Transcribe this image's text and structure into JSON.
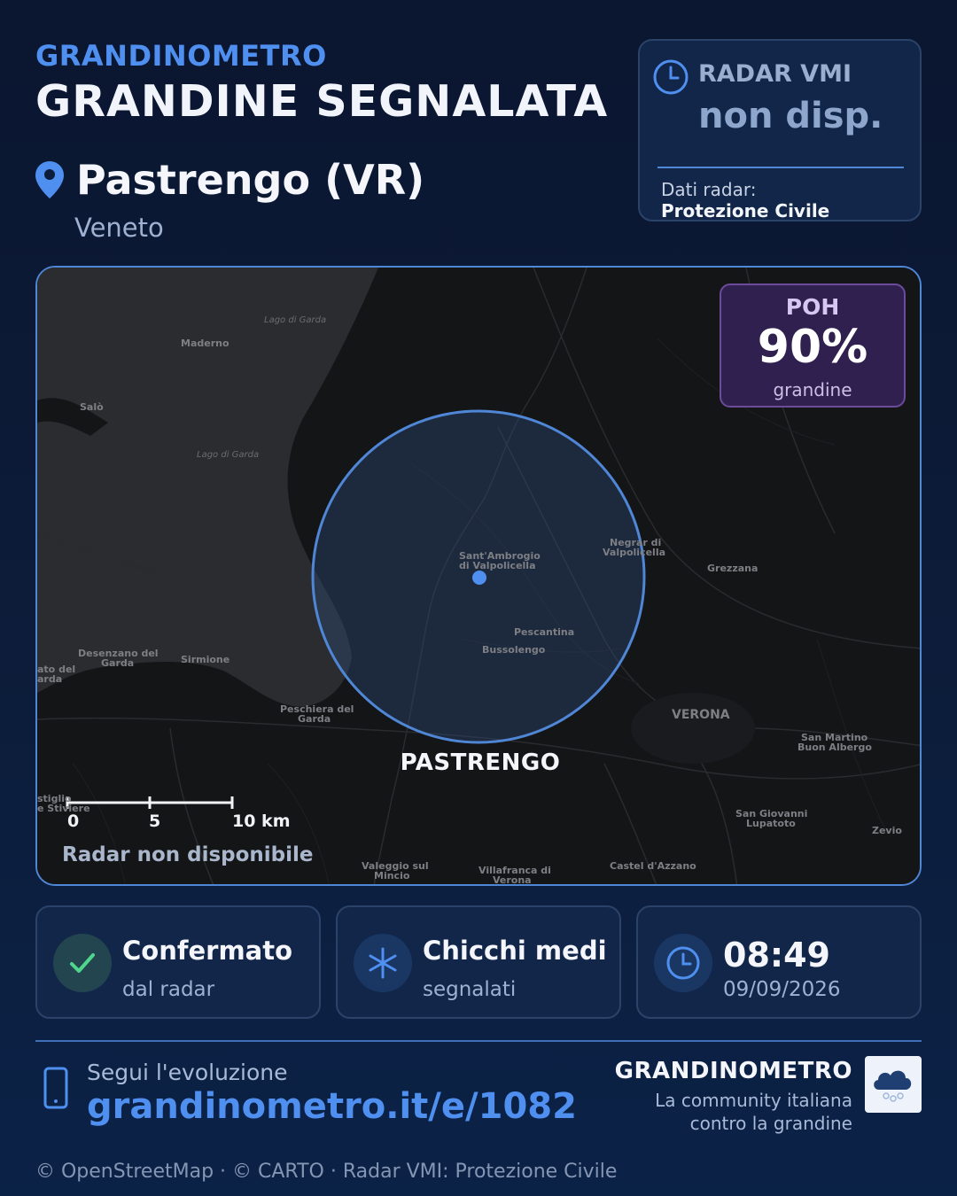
{
  "header": {
    "brand": "GRANDINOMETRO",
    "title": "GRANDINE SEGNALATA",
    "location": "Pastrengo (VR)",
    "region": "Veneto"
  },
  "radar": {
    "label": "RADAR VMI",
    "value": "non disp.",
    "source_label": "Dati radar:",
    "source_value": "Protezione Civile",
    "icon": "clock-icon"
  },
  "map": {
    "places": [
      "Lago di Garda",
      "Maderno",
      "Salò",
      "Lago di Garda",
      "Sant'Ambrogio",
      "di Valpolicella",
      "Negrar di",
      "Valpolicella",
      "Grezzana",
      "Pescantina",
      "Bussolengo",
      "Desenzano del",
      "Garda",
      "Sirmione",
      "ato del",
      "arda",
      "Peschiera del",
      "Garda",
      "VERONA",
      "San Martino",
      "Buon Albergo",
      "stiglio",
      "e Stiviere",
      "San Giovanni",
      "Lupatoto",
      "Zevio",
      "Valeggio sul",
      "Mincio",
      "Villafranca di",
      "Verona",
      "Castel d'Azzano"
    ],
    "poh_label": "POH",
    "poh_value": "90%",
    "poh_fraction": 0.9,
    "poh_sub": "grandine",
    "center_label": "PASTRENGO",
    "scale_ticks": [
      "0",
      "5",
      "10 km"
    ],
    "radar_status": "Radar non disponibile",
    "colors": {
      "circle": "#4f86d6",
      "water": "#2b2c2f",
      "land": "#141517",
      "poh_bg": "#30204f"
    }
  },
  "stats": [
    {
      "title": "Confermato",
      "sub": "dal radar",
      "icon": "check-icon"
    },
    {
      "title": "Chicchi medi",
      "sub": "segnalati",
      "icon": "snowflake-icon"
    },
    {
      "title": "08:49",
      "sub": "09/09/2026",
      "icon": "clock-icon"
    }
  ],
  "footer": {
    "follow_label": "Segui l'evoluzione",
    "follow_url": "grandinometro.it/e/1082",
    "brand": "GRANDINOMETRO",
    "tagline_1": "La community italiana",
    "tagline_2": "contro la grandine",
    "attribution": "© OpenStreetMap · © CARTO · Radar VMI: Protezione Civile"
  },
  "colors": {
    "accent": "#4f8ff0",
    "background": "#0c1d3b",
    "card": "#12264a"
  }
}
